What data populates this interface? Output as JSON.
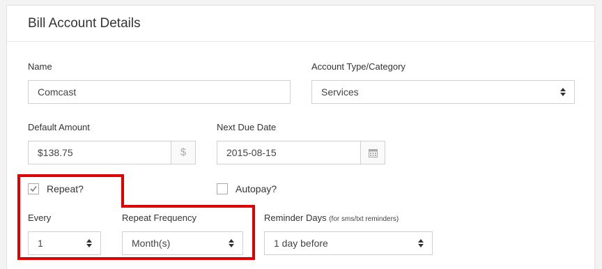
{
  "panel": {
    "title": "Bill Account Details"
  },
  "fields": {
    "name": {
      "label": "Name",
      "value": "Comcast"
    },
    "account_type": {
      "label": "Account Type/Category",
      "value": "Services"
    },
    "default_amount": {
      "label": "Default Amount",
      "value": "$138.75",
      "addon": "$"
    },
    "next_due_date": {
      "label": "Next Due Date",
      "value": "2015-08-15"
    },
    "repeat": {
      "label": "Repeat?",
      "checked": true
    },
    "autopay": {
      "label": "Autopay?",
      "checked": false
    },
    "every": {
      "label": "Every",
      "value": "1"
    },
    "repeat_frequency": {
      "label": "Repeat Frequency",
      "value": "Month(s)"
    },
    "reminder_days": {
      "label": "Reminder Days",
      "hint": "(for sms/txt reminders)",
      "value": "1 day before"
    }
  },
  "icons": {
    "select": "sort-arrows-icon",
    "dollar": "dollar-icon",
    "calendar": "calendar-icon",
    "check": "checkmark-icon"
  },
  "colors": {
    "highlight": "#e10000"
  }
}
